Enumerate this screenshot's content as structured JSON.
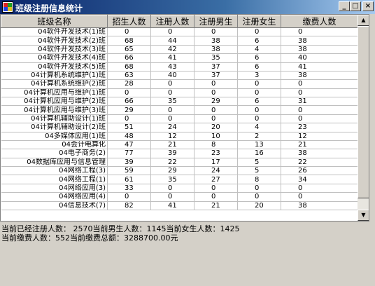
{
  "window": {
    "title": "班级注册信息统计",
    "buttons": {
      "minimize": "_",
      "maximize": "□",
      "close": "×"
    }
  },
  "grid": {
    "headers": [
      "班级名称",
      "招生人数",
      "注册人数",
      "注册男生",
      "注册女生",
      "缴费人数"
    ],
    "rows": [
      [
        "04软件开发技术(1)班",
        "0",
        "0",
        "0",
        "0",
        "0"
      ],
      [
        "04软件开发技术(2)班",
        "68",
        "44",
        "38",
        "6",
        "38"
      ],
      [
        "04软件开发技术(3)班",
        "65",
        "42",
        "38",
        "4",
        "38"
      ],
      [
        "04软件开发技术(4)班",
        "66",
        "41",
        "35",
        "6",
        "40"
      ],
      [
        "04软件开发技术(5)班",
        "68",
        "43",
        "37",
        "6",
        "41"
      ],
      [
        "04计算机系统维护(1)班",
        "63",
        "40",
        "37",
        "3",
        "38"
      ],
      [
        "04计算机系统维护(2)班",
        "28",
        "0",
        "0",
        "0",
        "0"
      ],
      [
        "04计算机应用与维护(1)班",
        "0",
        "0",
        "0",
        "0",
        "0"
      ],
      [
        "04计算机应用与维护(2)班",
        "66",
        "35",
        "29",
        "6",
        "31"
      ],
      [
        "04计算机应用与维护(3)班",
        "29",
        "0",
        "0",
        "0",
        "0"
      ],
      [
        "04计算机辅助设计(1)班",
        "0",
        "0",
        "0",
        "0",
        "0"
      ],
      [
        "04计算机辅助设计(2)班",
        "51",
        "24",
        "20",
        "4",
        "23"
      ],
      [
        "04多媒体应用(1)班",
        "48",
        "12",
        "10",
        "2",
        "12"
      ],
      [
        "04会计电算化",
        "47",
        "21",
        "8",
        "13",
        "21"
      ],
      [
        "04电子商务(2)",
        "77",
        "39",
        "23",
        "16",
        "38"
      ],
      [
        "04数据库应用与信息管理",
        "39",
        "22",
        "17",
        "5",
        "22"
      ],
      [
        "04网络工程(3)",
        "59",
        "29",
        "24",
        "5",
        "26"
      ],
      [
        "04网络工程(1)",
        "61",
        "35",
        "27",
        "8",
        "34"
      ],
      [
        "04网络应用(3)",
        "33",
        "0",
        "0",
        "0",
        "0"
      ],
      [
        "04网络应用(4)",
        "0",
        "0",
        "0",
        "0",
        "0"
      ],
      [
        "04信息技术(7)",
        "82",
        "41",
        "21",
        "20",
        "38"
      ]
    ]
  },
  "scrollbar": {
    "up_arrow": "▲",
    "down_arrow": "▼"
  },
  "status": {
    "line1": "当前已经注册人数： 2570当前男生人数：1145当前女生人数：1425",
    "line2": "当前缴费人数：552当前缴费总额：3288700.00元"
  }
}
